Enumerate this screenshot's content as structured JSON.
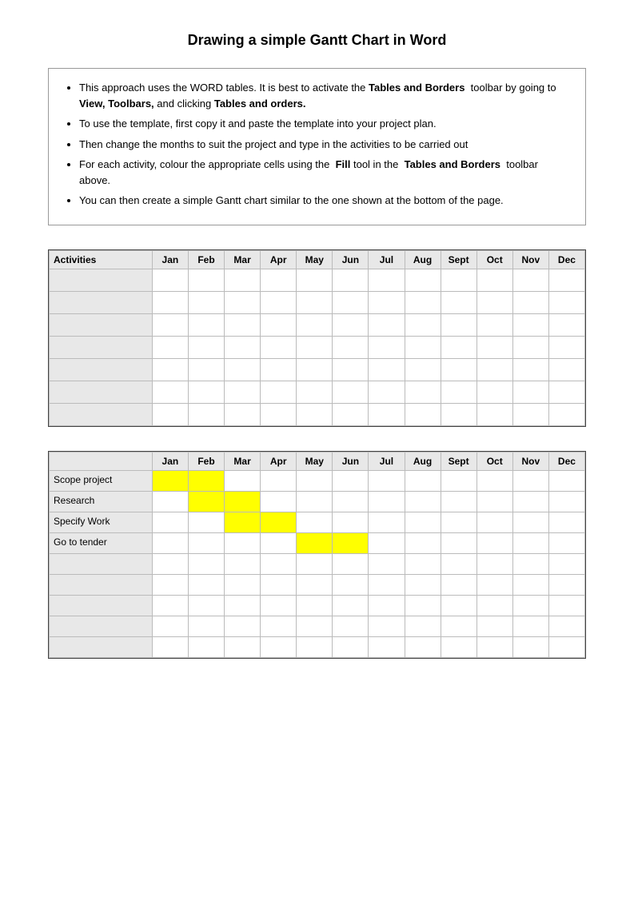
{
  "title": "Drawing a simple Gantt Chart in Word",
  "info_bullets": [
    {
      "text": "This approach uses the WORD tables. It is best to activate the ",
      "bold1": "Tables and Borders",
      "text2": "  toolbar by going to ",
      "bold2": "View, Toolbars,",
      "text3": " and clicking ",
      "bold3": "Tables and orders.",
      "full": "This approach uses the WORD tables. It is best to activate the Tables and Borders toolbar by going to View, Toolbars, and clicking Tables and orders."
    },
    {
      "full": "To use the template, first copy it and paste the template into your project plan."
    },
    {
      "full": "Then change the months to suit the project and type in the activities to be carried out"
    },
    {
      "full": "For each activity, colour the appropriate cells using the  Fill tool in the  Tables and Borders  toolbar above."
    },
    {
      "full": "You can then create a simple Gantt chart similar to the one shown at the bottom of the page."
    }
  ],
  "months": [
    "Jan",
    "Feb",
    "Mar",
    "Apr",
    "May",
    "Jun",
    "Jul",
    "Aug",
    "Sept",
    "Oct",
    "Nov",
    "Dec"
  ],
  "template_header": {
    "activity_col": "Activities"
  },
  "example_activities": [
    "Scope project",
    "Research",
    "Specify Work",
    "Go to tender"
  ],
  "example_gantt": [
    {
      "activity": "Scope project",
      "yellow_cols": [
        0,
        1
      ]
    },
    {
      "activity": "Research",
      "yellow_cols": [
        1,
        2
      ]
    },
    {
      "activity": "Specify Work",
      "yellow_cols": [
        2,
        3
      ]
    },
    {
      "activity": "Go to tender",
      "yellow_cols": [
        4,
        5
      ]
    }
  ]
}
